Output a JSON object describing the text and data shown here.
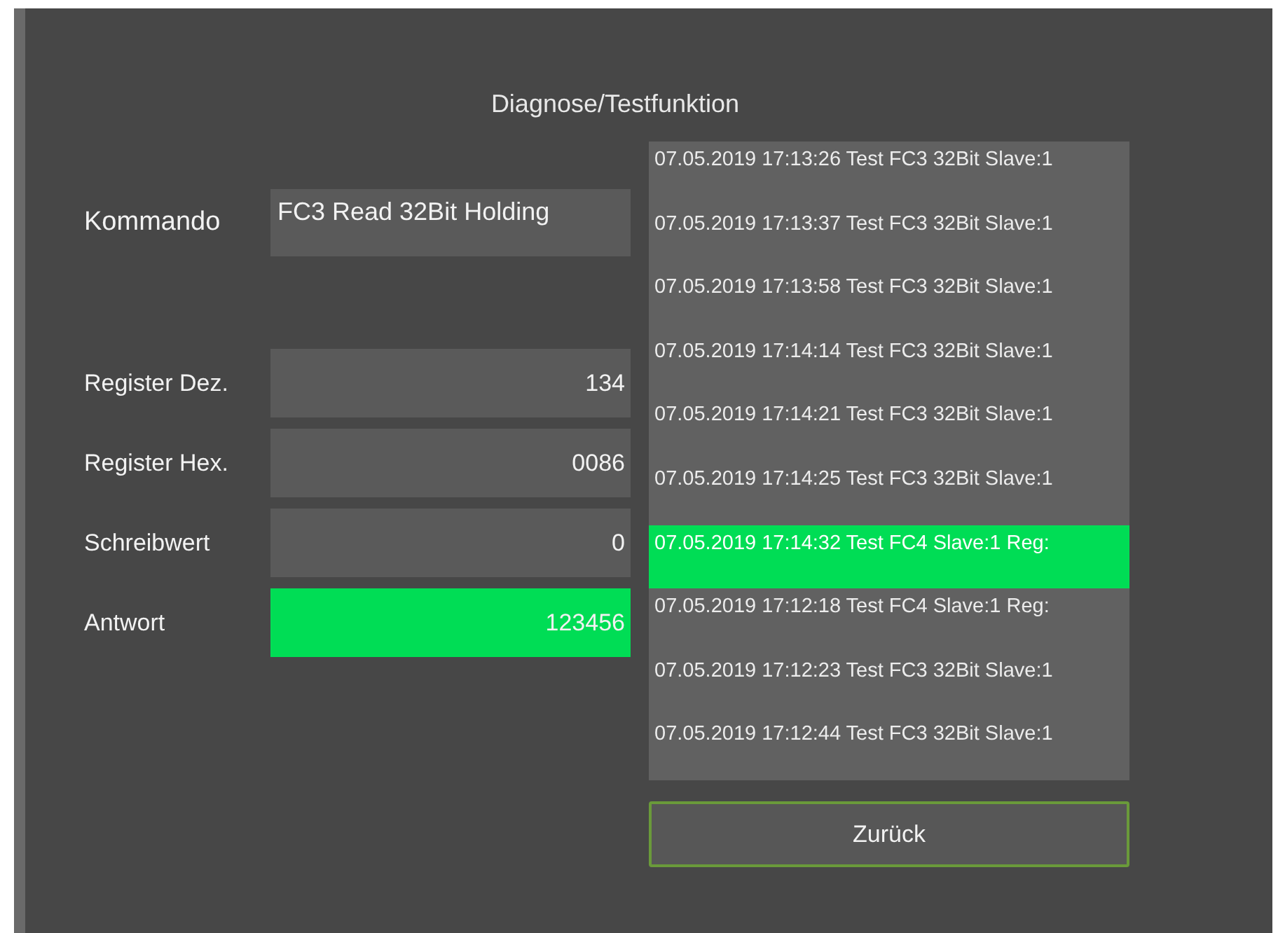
{
  "title": "Diagnose/Testfunktion",
  "command": {
    "label": "Kommando",
    "value": "FC3 Read 32Bit Holding"
  },
  "fields": [
    {
      "label": "Register Dez.",
      "value": "134",
      "highlighted": false
    },
    {
      "label": "Register Hex.",
      "value": "0086",
      "highlighted": false
    },
    {
      "label": "Schreibwert",
      "value": "0",
      "highlighted": false
    },
    {
      "label": "Antwort",
      "value": "123456",
      "highlighted": true
    }
  ],
  "log": [
    {
      "text": "07.05.2019 17:13:26 Test FC3 32Bit Slave:1",
      "selected": false
    },
    {
      "text": "07.05.2019 17:13:37 Test FC3 32Bit Slave:1",
      "selected": false
    },
    {
      "text": "07.05.2019 17:13:58 Test FC3 32Bit Slave:1",
      "selected": false
    },
    {
      "text": "07.05.2019 17:14:14 Test FC3 32Bit Slave:1",
      "selected": false
    },
    {
      "text": "07.05.2019 17:14:21 Test FC3 32Bit Slave:1",
      "selected": false
    },
    {
      "text": "07.05.2019 17:14:25 Test FC3 32Bit Slave:1",
      "selected": false
    },
    {
      "text": "07.05.2019 17:14:32 Test FC4 Slave:1 Reg:",
      "selected": true
    },
    {
      "text": "07.05.2019 17:12:18 Test FC4 Slave:1 Reg:",
      "selected": false
    },
    {
      "text": "07.05.2019 17:12:23 Test FC3 32Bit Slave:1",
      "selected": false
    },
    {
      "text": "07.05.2019 17:12:44 Test FC3 32Bit Slave:1",
      "selected": false
    }
  ],
  "back_button": "Zurück"
}
